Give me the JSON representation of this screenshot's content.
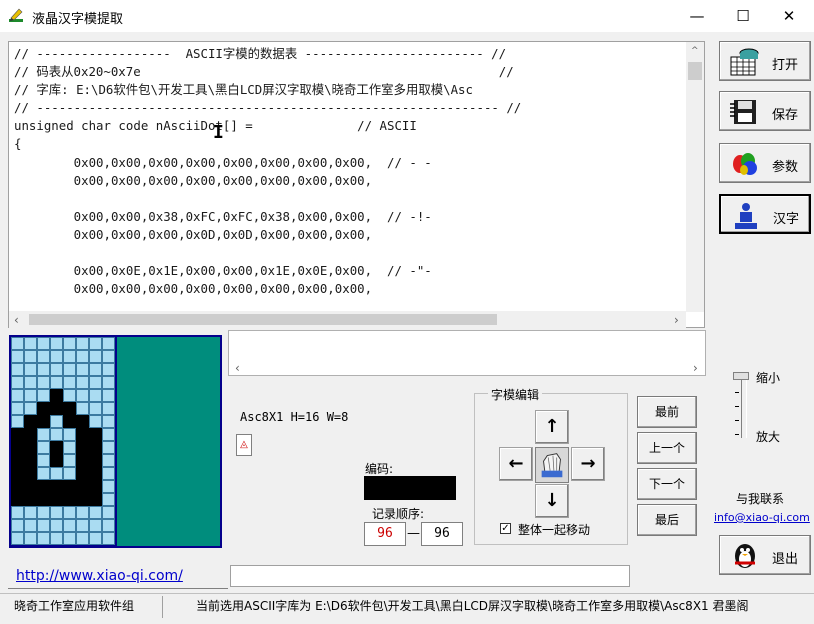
{
  "window": {
    "title": "液晶汉字模提取",
    "minimize": "—",
    "maximize": "☐",
    "close": "✕"
  },
  "editor": {
    "lines": [
      "// ------------------  ASCII字模的数据表 ------------------------ //",
      "// 码表从0x20~0x7e                                                //",
      "// 字库: E:\\D6软件包\\开发工具\\黑白LCD屏汉字取模\\晓奇工作室多用取模\\Asc",
      "// -------------------------------------------------------------- //",
      "unsigned char code nAsciiDot[] =              // ASCII",
      "{",
      "        0x00,0x00,0x00,0x00,0x00,0x00,0x00,0x00,  // - -",
      "        0x00,0x00,0x00,0x00,0x00,0x00,0x00,0x00,",
      "",
      "        0x00,0x00,0x38,0xFC,0xFC,0x38,0x00,0x00,  // -!-",
      "        0x00,0x00,0x00,0x0D,0x0D,0x00,0x00,0x00,",
      "",
      "        0x00,0x0E,0x1E,0x00,0x00,0x1E,0x0E,0x00,  // -\"-",
      "        0x00,0x00,0x00,0x00,0x00,0x00,0x00,0x00,"
    ]
  },
  "sidebar": {
    "open": "打开",
    "save": "保存",
    "params": "参数",
    "hanzi": "汉字",
    "exit": "退出"
  },
  "glyph": {
    "cols": 8,
    "rows": 16,
    "on": [
      "00000000",
      "00000000",
      "00000000",
      "00000000",
      "00010000",
      "00111000",
      "01101100",
      "11000110",
      "11010110",
      "11010110",
      "11000110",
      "11111110",
      "11111110",
      "00000000",
      "00000000",
      "00000000"
    ]
  },
  "info": {
    "label": "Asc8X1 H=16 W=8",
    "mini_icon": "◬"
  },
  "encoding": {
    "label": "编码:",
    "order_label": "记录顺序:",
    "order_from": "96",
    "order_to": "96",
    "dash": "—"
  },
  "edit_group": {
    "title": "字模编辑",
    "up": "↑",
    "down": "↓",
    "left": "←",
    "right": "→",
    "move_all_label": "整体一起移动",
    "move_all_checked": "✓"
  },
  "nav": {
    "first": "最前",
    "prev": "上一个",
    "next": "下一个",
    "last": "最后"
  },
  "zoom": {
    "out": "缩小",
    "in": "放大"
  },
  "contact": {
    "label": "与我联系",
    "email": "info@xiao-qi.com"
  },
  "footer": {
    "url": "http://www.xiao-qi.com/",
    "status_left": "晓奇工作室应用软件组",
    "status_right": "当前选用ASCII字库为 E:\\D6软件包\\开发工具\\黑白LCD屏汉字取模\\晓奇工作室多用取模\\Asc8X1 君墨阁"
  },
  "colors": {
    "grid_off": "#aadcf2",
    "grid_on": "#000000",
    "panel_border": "#05008c",
    "panel_right": "#008d7d",
    "order_from": "#cc0000"
  }
}
